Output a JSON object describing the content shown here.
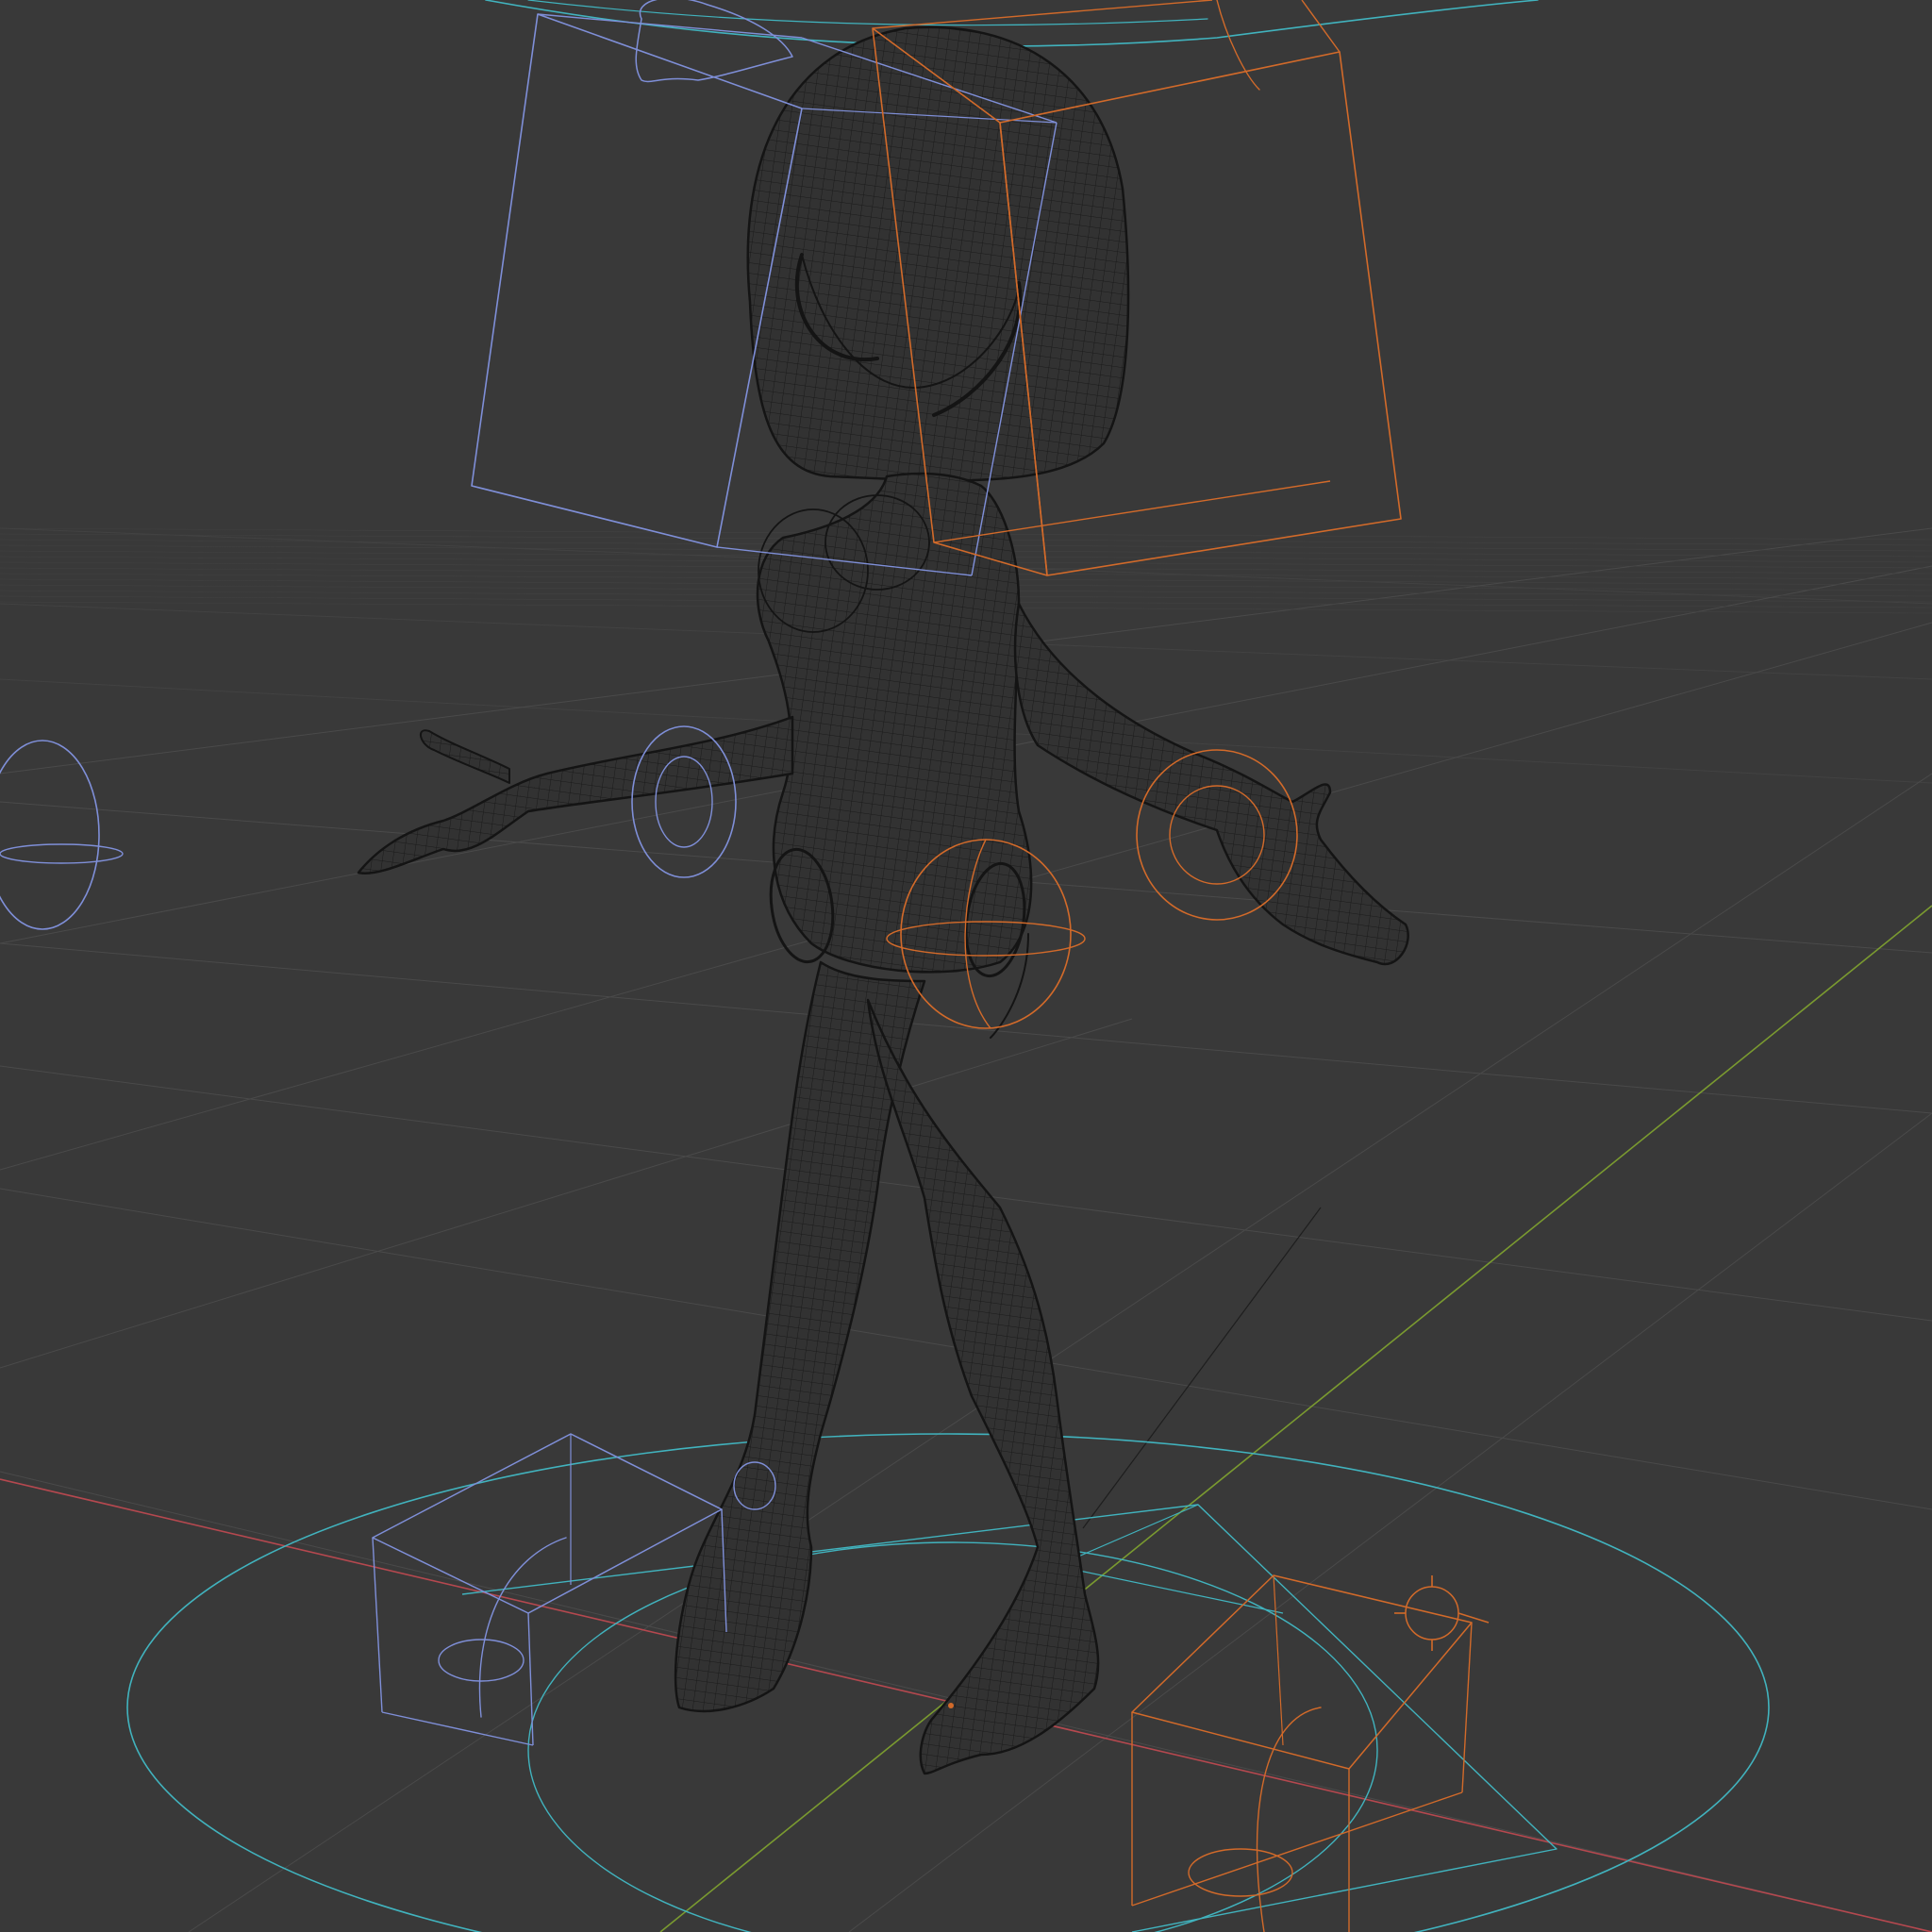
{
  "viewport": {
    "mode": "wireframe",
    "background": "#393939",
    "grid_color": "#4a4a4a",
    "grid_color_far": "#424242",
    "x_axis_color": "#b5484f",
    "y_axis_color": "#7a9a30",
    "mesh_color": "#141414"
  },
  "controls": {
    "left_side_color": "#7f8fd8",
    "right_side_color": "#d26a2a",
    "root_color": "#41b3be"
  },
  "scene": {
    "objects": [
      {
        "name": "character-mesh",
        "type": "mesh"
      },
      {
        "name": "head-control-left",
        "type": "bone-shape"
      },
      {
        "name": "head-control-right",
        "type": "bone-shape"
      },
      {
        "name": "root-control",
        "type": "bone-shape"
      },
      {
        "name": "foot-ik-left",
        "type": "bone-shape"
      },
      {
        "name": "foot-ik-right",
        "type": "bone-shape"
      },
      {
        "name": "arm-pole-left",
        "type": "bone-shape"
      },
      {
        "name": "elbow-control-left",
        "type": "bone-shape"
      },
      {
        "name": "elbow-control-right",
        "type": "bone-shape"
      },
      {
        "name": "hip-control-right",
        "type": "bone-shape"
      }
    ]
  }
}
